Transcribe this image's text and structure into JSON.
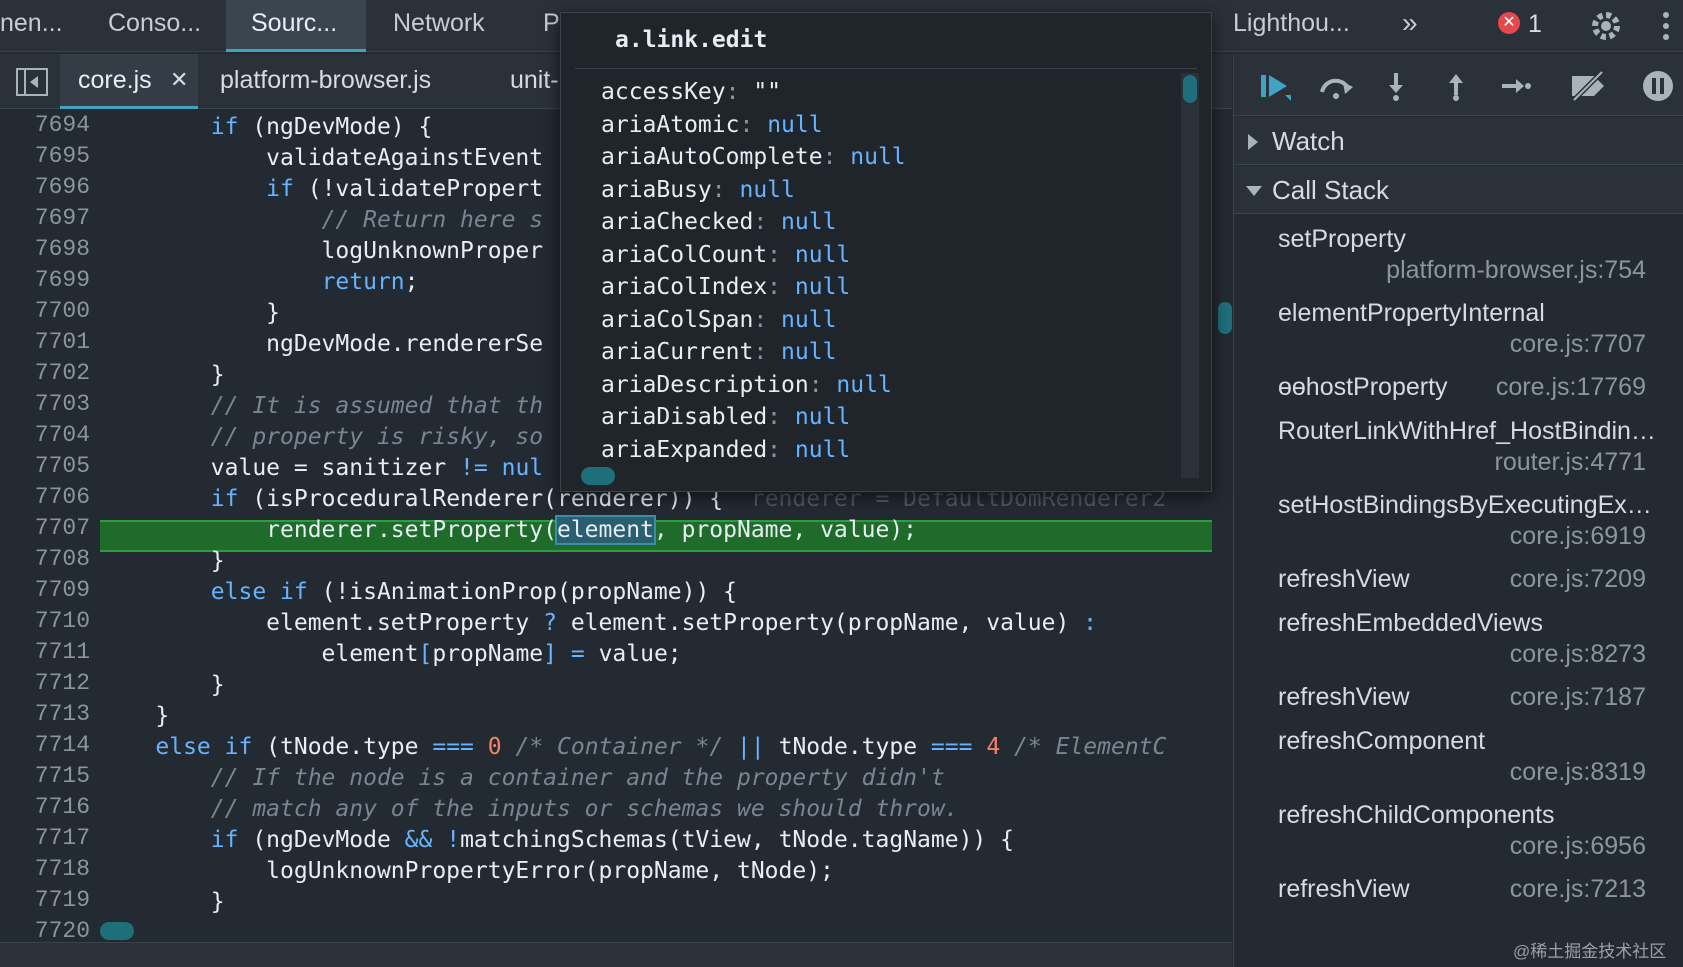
{
  "top_tabs": [
    "nen...",
    "Conso...",
    "Sourc...",
    "Network",
    "P",
    "Lighthou..."
  ],
  "top_more": "»",
  "error_count": "1",
  "file_tabs": [
    "core.js",
    "platform-browser.js",
    "unit-"
  ],
  "close_glyph": "✕",
  "editor": {
    "line_numbers": [
      "7694",
      "7695",
      "7696",
      "7697",
      "7698",
      "7699",
      "7700",
      "7701",
      "7702",
      "7703",
      "7704",
      "7705",
      "7706",
      "7707",
      "7708",
      "7709",
      "7710",
      "7711",
      "7712",
      "7713",
      "7714",
      "7715",
      "7716",
      "7717",
      "7718",
      "7719",
      "7720"
    ],
    "lines": [
      [
        {
          "t": "        "
        },
        {
          "t": "if",
          "c": "kw"
        },
        {
          "t": " (ngDevMode) {"
        }
      ],
      [
        {
          "t": "            validateAgainstEvent"
        }
      ],
      [
        {
          "t": "            "
        },
        {
          "t": "if",
          "c": "kw"
        },
        {
          "t": " (!validatePropert"
        }
      ],
      [
        {
          "t": "                "
        },
        {
          "t": "// Return here s",
          "c": "cm"
        }
      ],
      [
        {
          "t": "                logUnknownProper"
        }
      ],
      [
        {
          "t": "                "
        },
        {
          "t": "return",
          "c": "kw"
        },
        {
          "t": ";"
        }
      ],
      [
        {
          "t": "            }"
        }
      ],
      [
        {
          "t": "            ngDevMode.rendererSe"
        }
      ],
      [
        {
          "t": "        }"
        }
      ],
      [
        {
          "t": "        "
        },
        {
          "t": "// It is assumed that th",
          "c": "cm"
        }
      ],
      [
        {
          "t": "        "
        },
        {
          "t": "// property is risky, so",
          "c": "cm"
        }
      ],
      [
        {
          "t": "        value = sanitizer "
        },
        {
          "t": "!=",
          "c": "op"
        },
        {
          "t": " "
        },
        {
          "t": "nul",
          "c": "kw"
        }
      ],
      [
        {
          "t": "        "
        },
        {
          "t": "if",
          "c": "kw"
        },
        {
          "t": " (isProceduralRenderer(renderer)) {  "
        },
        {
          "t": "renderer = DefaultDomRenderer2",
          "c": "ghost"
        }
      ],
      [
        {
          "t": "            renderer.setProperty("
        },
        {
          "t": "element",
          "c": "hl"
        },
        {
          "t": ", propName, value);"
        }
      ],
      [
        {
          "t": "        }"
        }
      ],
      [
        {
          "t": "        "
        },
        {
          "t": "else if",
          "c": "kw"
        },
        {
          "t": " (!isAnimationProp(propName)) {"
        }
      ],
      [
        {
          "t": "            element.setProperty "
        },
        {
          "t": "?",
          "c": "op"
        },
        {
          "t": " element.setProperty(propName, value) "
        },
        {
          "t": ":",
          "c": "op"
        }
      ],
      [
        {
          "t": "                element"
        },
        {
          "t": "[",
          "c": "op"
        },
        {
          "t": "propName"
        },
        {
          "t": "]",
          "c": "op"
        },
        {
          "t": " "
        },
        {
          "t": "=",
          "c": "op"
        },
        {
          "t": " value;"
        }
      ],
      [
        {
          "t": "        }"
        }
      ],
      [
        {
          "t": "    }"
        }
      ],
      [
        {
          "t": "    "
        },
        {
          "t": "else if",
          "c": "kw"
        },
        {
          "t": " (tNode.type "
        },
        {
          "t": "===",
          "c": "op"
        },
        {
          "t": " "
        },
        {
          "t": "0",
          "c": "num"
        },
        {
          "t": " "
        },
        {
          "t": "/* Container */",
          "c": "cm"
        },
        {
          "t": " "
        },
        {
          "t": "||",
          "c": "op"
        },
        {
          "t": " tNode.type "
        },
        {
          "t": "===",
          "c": "op"
        },
        {
          "t": " "
        },
        {
          "t": "4",
          "c": "num"
        },
        {
          "t": " "
        },
        {
          "t": "/* ElementC",
          "c": "cm"
        }
      ],
      [
        {
          "t": "        "
        },
        {
          "t": "// If the node is a container and the property didn't",
          "c": "cm"
        }
      ],
      [
        {
          "t": "        "
        },
        {
          "t": "// match any of the inputs or schemas we should throw.",
          "c": "cm"
        }
      ],
      [
        {
          "t": "        "
        },
        {
          "t": "if",
          "c": "kw"
        },
        {
          "t": " (ngDevMode "
        },
        {
          "t": "&&",
          "c": "op"
        },
        {
          "t": " "
        },
        {
          "t": "!",
          "c": "op"
        },
        {
          "t": "matchingSchemas(tView, tNode.tagName)) {"
        }
      ],
      [
        {
          "t": "            logUnknownPropertyError(propName, tNode);"
        }
      ],
      [
        {
          "t": "        }"
        }
      ],
      [
        {
          "t": ""
        }
      ]
    ]
  },
  "popover": {
    "title": "a.link.edit",
    "props": [
      {
        "key": "accessKey",
        "val": "\"\"",
        "str": true
      },
      {
        "key": "ariaAtomic",
        "val": "null"
      },
      {
        "key": "ariaAutoComplete",
        "val": "null"
      },
      {
        "key": "ariaBusy",
        "val": "null"
      },
      {
        "key": "ariaChecked",
        "val": "null"
      },
      {
        "key": "ariaColCount",
        "val": "null"
      },
      {
        "key": "ariaColIndex",
        "val": "null"
      },
      {
        "key": "ariaColSpan",
        "val": "null"
      },
      {
        "key": "ariaCurrent",
        "val": "null"
      },
      {
        "key": "ariaDescription",
        "val": "null"
      },
      {
        "key": "ariaDisabled",
        "val": "null"
      },
      {
        "key": "ariaExpanded",
        "val": "null"
      }
    ]
  },
  "sidebar": {
    "watch_label": "Watch",
    "callstack_label": "Call Stack",
    "frames": [
      {
        "fn": "setProperty",
        "loc": "platform-browser.js:754",
        "wrap": true
      },
      {
        "fn": "elementPropertyInternal",
        "loc": "core.js:7707",
        "wrap": true
      },
      {
        "fn": "ɵɵhostProperty",
        "loc": "core.js:17769",
        "wrap": false
      },
      {
        "fn": "RouterLinkWithHref_HostBindin…",
        "loc": "router.js:4771",
        "wrap": true
      },
      {
        "fn": "setHostBindingsByExecutingEx…",
        "loc": "core.js:6919",
        "wrap": true
      },
      {
        "fn": "refreshView",
        "loc": "core.js:7209",
        "wrap": false
      },
      {
        "fn": "refreshEmbeddedViews",
        "loc": "core.js:8273",
        "wrap": true
      },
      {
        "fn": "refreshView",
        "loc": "core.js:7187",
        "wrap": false
      },
      {
        "fn": "refreshComponent",
        "loc": "core.js:8319",
        "wrap": true
      },
      {
        "fn": "refreshChildComponents",
        "loc": "core.js:6956",
        "wrap": true
      },
      {
        "fn": "refreshView",
        "loc": "core.js:7213",
        "wrap": false
      }
    ]
  },
  "watermark": "@稀土掘金技术社区",
  "colors": {
    "accent": "#3fa3c5",
    "exec_line": "#1e6b2a",
    "error": "#e5484d"
  }
}
